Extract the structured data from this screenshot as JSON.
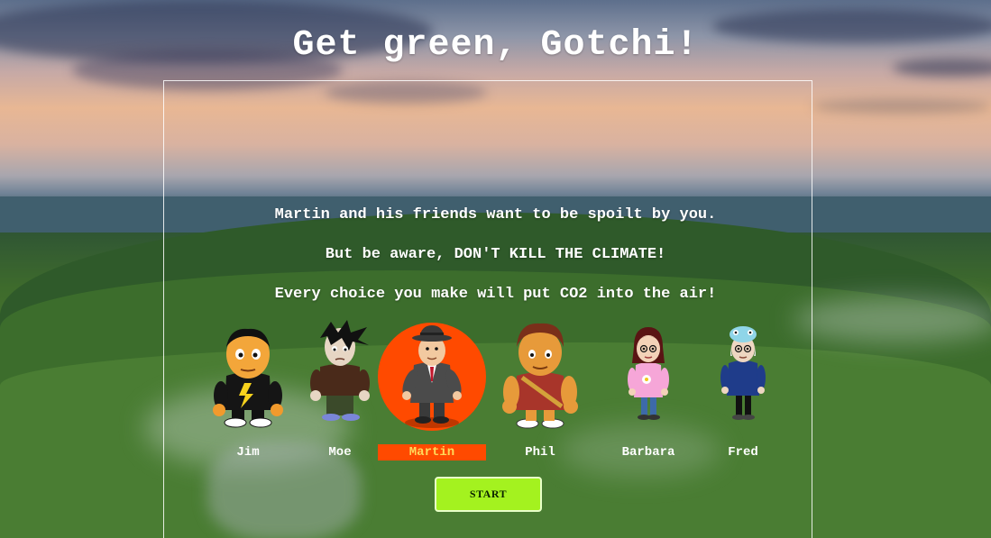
{
  "title": "Get green, Gotchi!",
  "intro": {
    "line1": "Martin and his friends want to be spoilt by you.",
    "line2": "But be aware, DON'T KILL THE CLIMATE!",
    "line3": "Every choice you make will put CO2 into the air!"
  },
  "characters": [
    {
      "name": "Jim",
      "selected": false
    },
    {
      "name": "Moe",
      "selected": false
    },
    {
      "name": "Martin",
      "selected": true
    },
    {
      "name": "Phil",
      "selected": false
    },
    {
      "name": "Barbara",
      "selected": false
    },
    {
      "name": "Fred",
      "selected": false
    }
  ],
  "start_label": "START",
  "colors": {
    "selection": "#ff4a00",
    "selected_name_text": "#ffd95a",
    "start_button": "#a4f21f"
  }
}
